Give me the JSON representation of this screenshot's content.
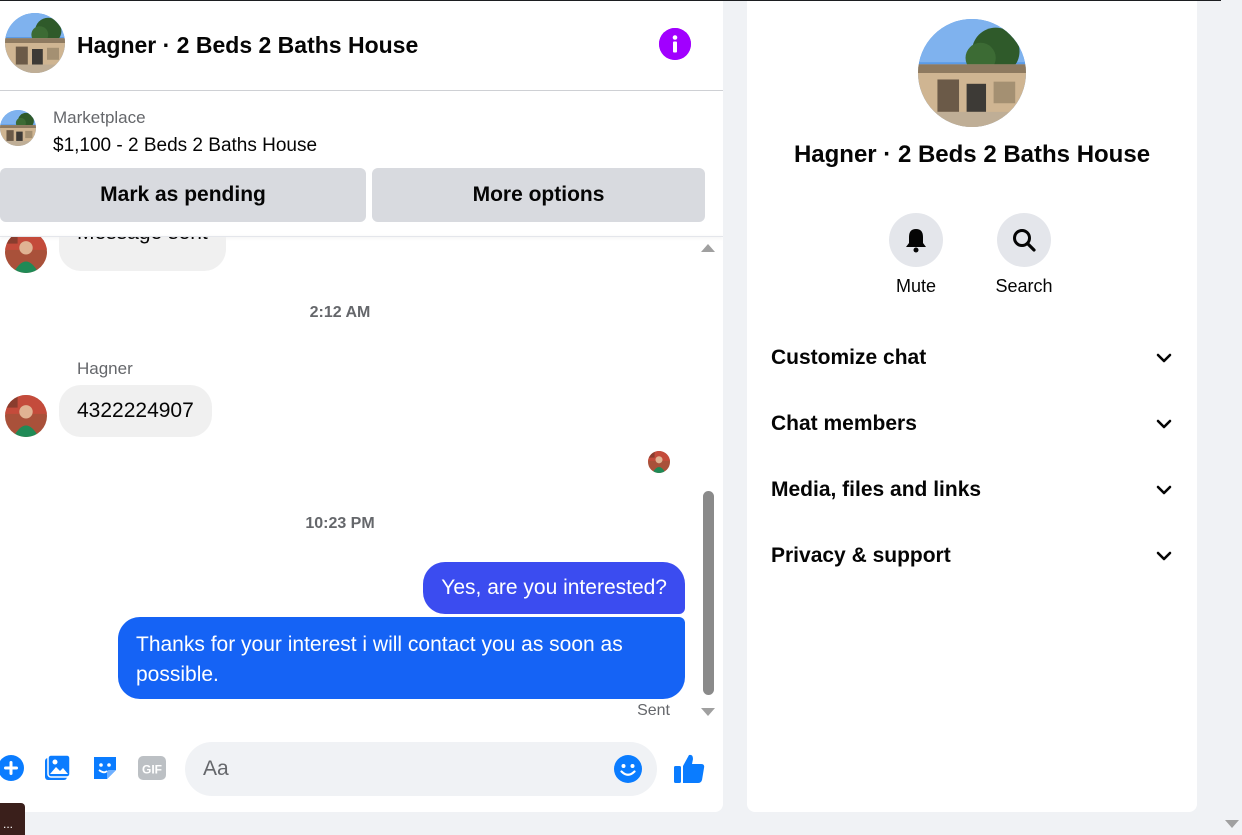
{
  "conversation": {
    "title": "Hagner · 2 Beds 2 Baths House",
    "info_icon": "info-icon"
  },
  "marketplace": {
    "label": "Marketplace",
    "listing": "$1,100 - 2 Beds 2 Baths House",
    "buttons": {
      "pending": "Mark as pending",
      "more": "More options"
    }
  },
  "messages": {
    "partial_text": "Message sent",
    "timestamp_1": "2:12 AM",
    "sender_name": "Hagner",
    "incoming_1": "4322224907",
    "timestamp_2": "10:23 PM",
    "outgoing_1": "Yes, are you interested?",
    "outgoing_2": "Thanks for your interest i will contact you as soon as possible.",
    "status": "Sent"
  },
  "composer": {
    "placeholder": "Aa",
    "icons": [
      "plus-icon",
      "image-icon",
      "sticker-icon",
      "gif-icon",
      "emoji-icon",
      "thumbs-up-icon"
    ],
    "gif_text": "GIF"
  },
  "info_panel": {
    "title": "Hagner · 2 Beds 2 Baths House",
    "actions": [
      {
        "label": "Mute",
        "icon": "bell-icon"
      },
      {
        "label": "Search",
        "icon": "search-icon"
      }
    ],
    "sections": [
      {
        "label": "Customize chat"
      },
      {
        "label": "Chat members"
      },
      {
        "label": "Media, files and links"
      },
      {
        "label": "Privacy & support"
      }
    ]
  },
  "colors": {
    "accent_purple": "#a100ff",
    "bubble_blue_top": "#3b4cf0",
    "bubble_blue": "#1563f5",
    "messenger_blue": "#0a7cff"
  },
  "mini_tab": "..."
}
